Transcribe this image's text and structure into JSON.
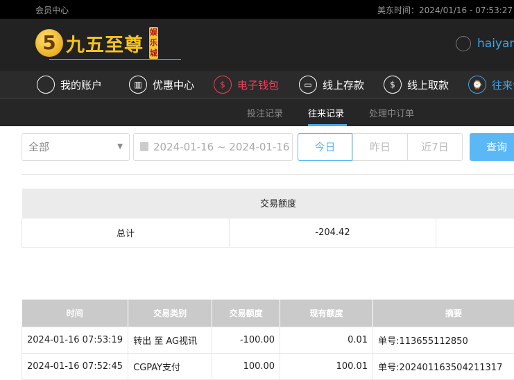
{
  "topbar": {
    "member_center": "会员中心",
    "time_label": "美东时间：2024/01/16 - 07:53:27"
  },
  "header": {
    "logo_text": "九五至尊",
    "logo_badge": "娱乐城",
    "username": "haiyan"
  },
  "nav": [
    {
      "label": "我的账户",
      "icon": "user-icon"
    },
    {
      "label": "优惠中心",
      "icon": "gift-icon"
    },
    {
      "label": "电子钱包",
      "icon": "wallet-icon"
    },
    {
      "label": "线上存款",
      "icon": "deposit-icon"
    },
    {
      "label": "线上取款",
      "icon": "withdraw-icon"
    },
    {
      "label": "往来记录",
      "icon": "records-icon"
    }
  ],
  "subnav": [
    {
      "label": "投注记录"
    },
    {
      "label": "往来记录"
    },
    {
      "label": "处理中订单"
    }
  ],
  "filters": {
    "type_value": "全部",
    "date_range": "2024-01-16 ~ 2024-01-16",
    "quick": [
      "今日",
      "昨日",
      "近7日"
    ],
    "query_label": "查询"
  },
  "summary": {
    "header": "交易额度",
    "row_label": "总计",
    "amount": "-204.42"
  },
  "records": {
    "columns": [
      "时间",
      "交易类别",
      "交易额度",
      "现有额度",
      "摘要"
    ],
    "rows": [
      [
        "2024-01-16 07:53:19",
        "转出 至 AG视讯",
        "-100.00",
        "0.01",
        "单号:113655112850"
      ],
      [
        "2024-01-16 07:52:45",
        "CGPAY支付",
        "100.00",
        "100.01",
        "单号:202401163504211317"
      ]
    ]
  },
  "colors": {
    "accent": "#5bb8f5",
    "active_nav": "#f0405c",
    "brand_gold": "#f6c21c"
  }
}
